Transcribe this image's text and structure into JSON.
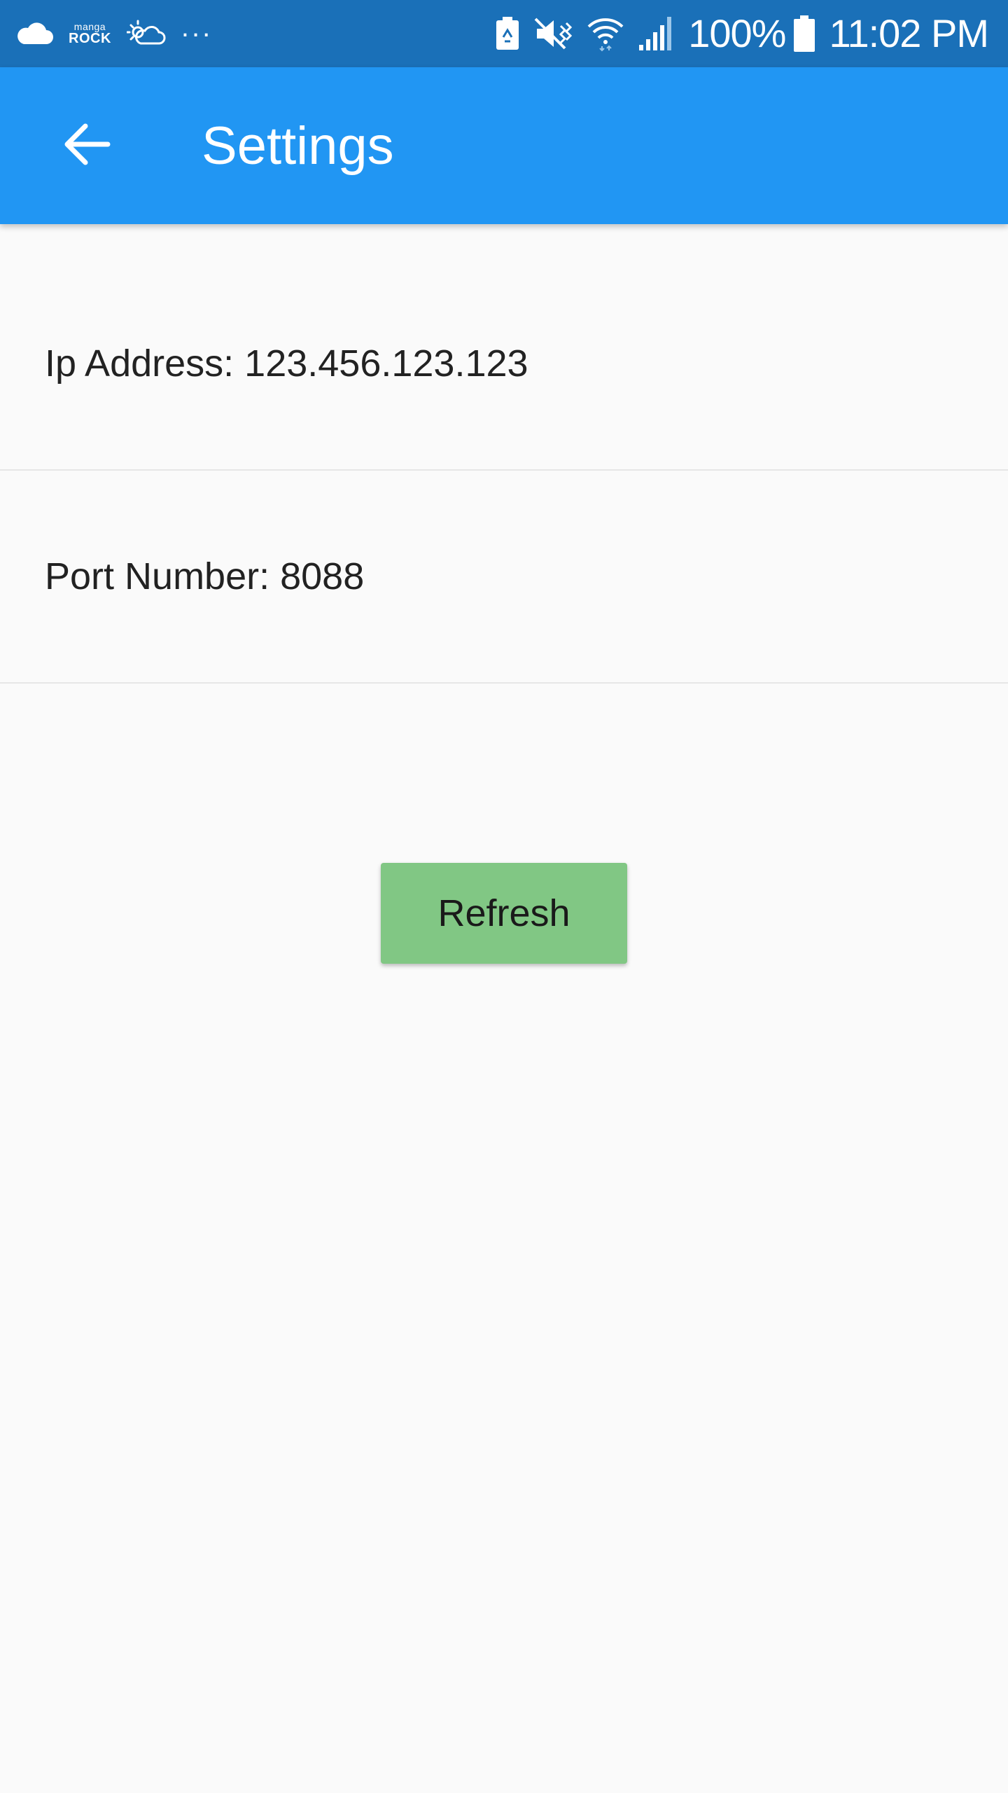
{
  "status_bar": {
    "background": "#1a70b8",
    "left_icons": [
      "cloud-icon",
      "manga-rock-icon",
      "weather-icon",
      "more-notifications-icon"
    ],
    "manga_rock_top": "manga",
    "manga_rock_bottom": "ROCK",
    "more_notifications": "...",
    "right_icons": [
      "battery-saver-icon",
      "vibrate-mute-icon",
      "wifi-icon",
      "cell-signal-icon",
      "battery-icon"
    ],
    "battery_percent": "100%",
    "time": "11:02 PM"
  },
  "app_bar": {
    "background": "#2196f3",
    "title": "Settings",
    "back_icon": "back-arrow-icon"
  },
  "settings": {
    "ip_address": "Ip Address: 123.456.123.123",
    "port_number": "Port Number: 8088"
  },
  "actions": {
    "refresh_label": "Refresh",
    "refresh_color": "#81c784"
  }
}
